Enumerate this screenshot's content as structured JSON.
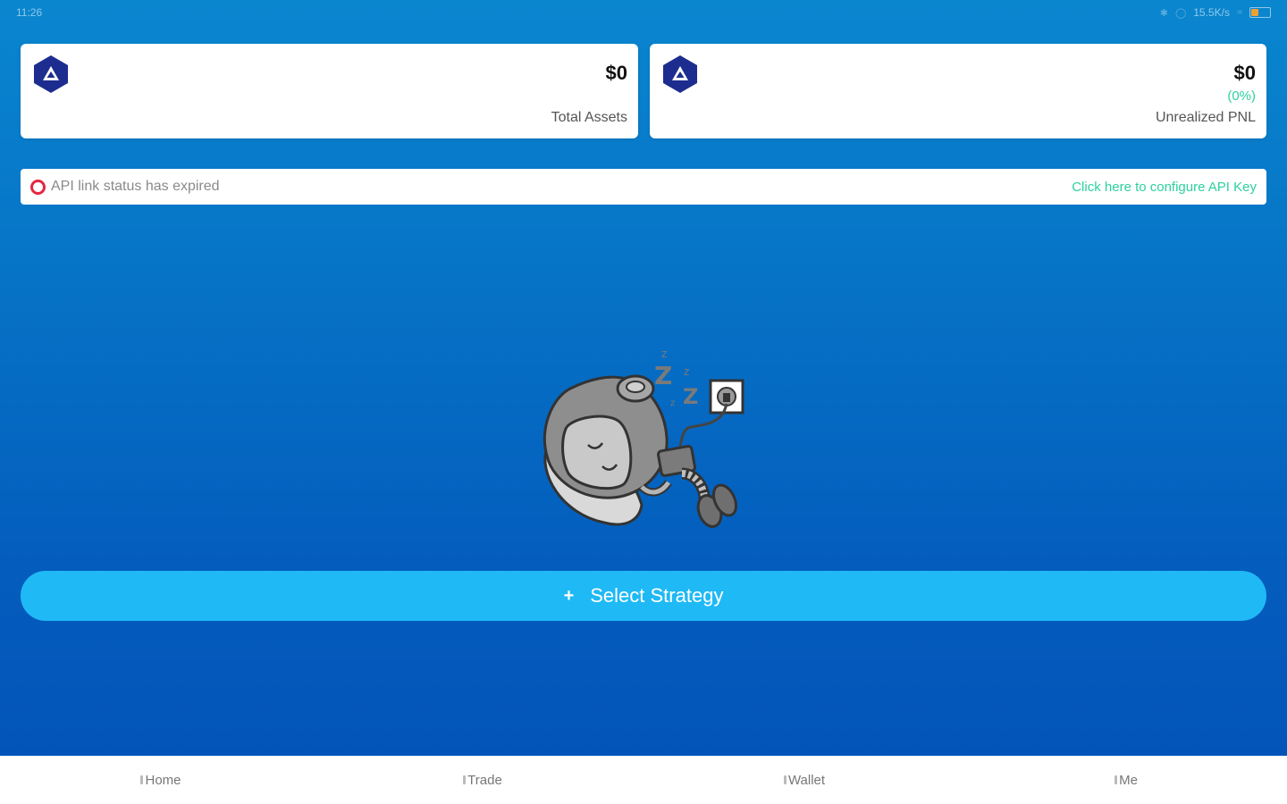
{
  "status_bar": {
    "time": "11:26",
    "network_speed": "15.5K/s"
  },
  "cards": {
    "total_assets": {
      "amount": "$0",
      "label": "Total Assets"
    },
    "unrealized_pnl": {
      "amount": "$0",
      "percent": "(0%)",
      "label": "Unrealized PNL"
    }
  },
  "api_bar": {
    "status_text": "API link status has expired",
    "configure_link": "Click here to configure API Key"
  },
  "main": {
    "select_strategy_label": "Select Strategy",
    "plus_symbol": "+"
  },
  "bottom_nav": {
    "items": [
      {
        "label": "Home"
      },
      {
        "label": "Trade"
      },
      {
        "label": "Wallet"
      },
      {
        "label": "Me"
      }
    ]
  },
  "colors": {
    "background_top": "#0a86cf",
    "background_bottom": "#0352b8",
    "button": "#1fb9f5",
    "accent_green": "#2ed0a0",
    "alert_red": "#e52740",
    "logo_navy": "#1d2d8f"
  }
}
